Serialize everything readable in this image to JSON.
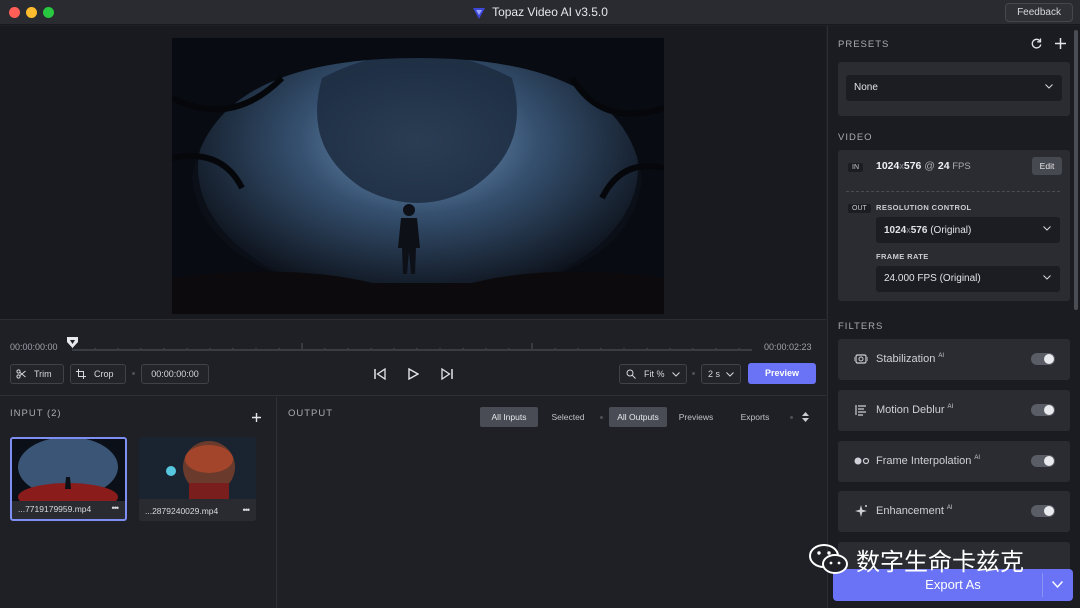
{
  "window": {
    "title": "Topaz Video AI  v3.5.0",
    "feedback_label": "Feedback"
  },
  "timeline": {
    "start_time": "00:00:00:00",
    "end_time": "00:00:02:23"
  },
  "toolbar": {
    "trim_label": "Trim",
    "crop_label": "Crop",
    "current_time": "00:00:00:00",
    "zoom_label": "Fit %",
    "step_label": "2 s",
    "preview_label": "Preview"
  },
  "input": {
    "title": "INPUT (2)",
    "items": [
      {
        "name": "...7719179959.mp4",
        "more": "•••"
      },
      {
        "name": "...2879240029.mp4",
        "more": "•••"
      }
    ]
  },
  "output": {
    "title": "OUTPUT",
    "filters_a": [
      "All Inputs",
      "Selected"
    ],
    "filters_b": [
      "All Outputs",
      "Previews",
      "Exports"
    ]
  },
  "presets": {
    "title": "PRESETS",
    "value": "None"
  },
  "video": {
    "title": "VIDEO",
    "in_tag": "IN",
    "in_res": "1024",
    "in_x": "x",
    "in_res_h": "576",
    "in_at": " @ ",
    "in_fps": "24",
    "in_fps_unit": " FPS",
    "edit_label": "Edit",
    "out_tag": "OUT",
    "resolution_label": "RESOLUTION CONTROL",
    "res_w": "1024",
    "res_x": "x",
    "res_h": "576",
    "res_note": " (Original)",
    "frame_rate_label": "FRAME RATE",
    "frame_rate_value": "24.000 FPS (Original)"
  },
  "filters": {
    "title": "FILTERS",
    "items": [
      {
        "label": "Stabilization",
        "ai": "AI",
        "enabled": false,
        "icon": "stabilization-icon"
      },
      {
        "label": "Motion Deblur",
        "ai": "AI",
        "enabled": false,
        "icon": "motion-deblur-icon"
      },
      {
        "label": "Frame Interpolation",
        "ai": "AI",
        "enabled": false,
        "icon": "frame-interpolation-icon"
      },
      {
        "label": "Enhancement",
        "ai": "AI",
        "enabled": false,
        "icon": "enhancement-icon"
      }
    ]
  },
  "export": {
    "label": "Export As"
  },
  "watermark": {
    "text": "数字生命卡兹克"
  },
  "colors": {
    "accent": "#6a73f5",
    "panel": "#2b2c32",
    "background": "#1f2026"
  }
}
